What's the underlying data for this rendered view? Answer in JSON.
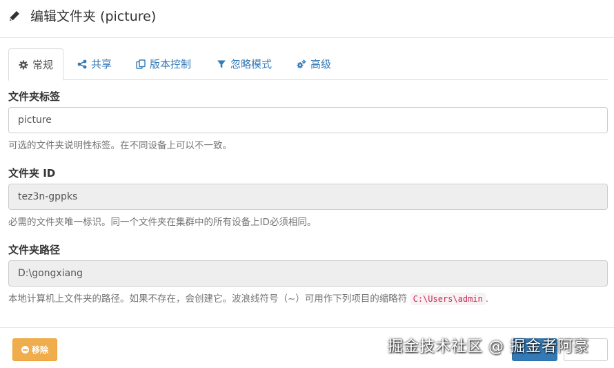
{
  "header": {
    "title": "编辑文件夹 (picture)"
  },
  "tabs": [
    {
      "label": "常规",
      "icon": "gear-icon"
    },
    {
      "label": "共享",
      "icon": "share-icon"
    },
    {
      "label": "版本控制",
      "icon": "copy-icon"
    },
    {
      "label": "忽略模式",
      "icon": "filter-icon"
    },
    {
      "label": "高级",
      "icon": "cogs-icon"
    }
  ],
  "form": {
    "label": {
      "label": "文件夹标签",
      "value": "picture",
      "help": "可选的文件夹说明性标签。在不同设备上可以不一致。"
    },
    "id": {
      "label": "文件夹 ID",
      "value": "tez3n-gppks",
      "help": "必需的文件夹唯一标识。同一个文件夹在集群中的所有设备上ID必须相同。"
    },
    "path": {
      "label": "文件夹路径",
      "value": "D:\\gongxiang",
      "help": "本地计算机上文件夹的路径。如果不存在，会创建它。波浪线符号（~）可用作下列项目的缩略符",
      "code": "C:\\Users\\admin",
      "help_end": "."
    }
  },
  "footer": {
    "remove_label": "移除"
  },
  "watermark": "掘金技术社区 @ 掘金者阿豪",
  "colors": {
    "link": "#337ab7",
    "warning": "#f0ad4e",
    "primary": "#337ab7"
  }
}
